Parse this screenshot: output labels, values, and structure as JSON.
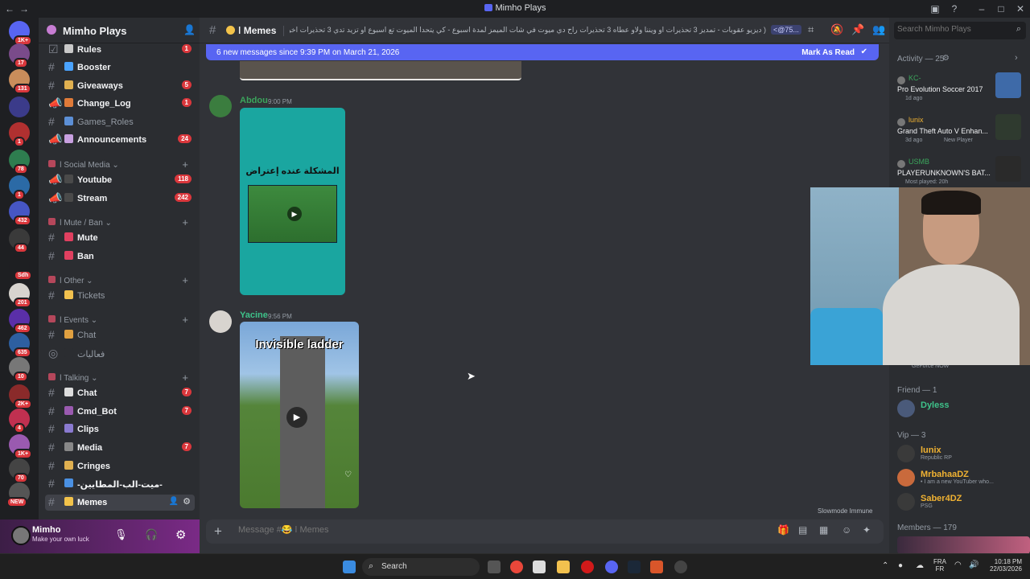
{
  "window": {
    "title": "Mimho Plays"
  },
  "rail": {
    "badges": [
      "1K+",
      "17",
      "131",
      "",
      "1",
      "78",
      "1",
      "432",
      "44",
      "Sdh",
      "201",
      "462",
      "635",
      "10",
      "2K+",
      "4",
      "1K+",
      "70",
      "NEW"
    ]
  },
  "guild": {
    "name": "Mimho Plays"
  },
  "channels": [
    {
      "label": "Rules",
      "badge": "1",
      "unread": true,
      "kind": "rules"
    },
    {
      "label": "Booster",
      "badge": "",
      "unread": true,
      "kind": "text"
    },
    {
      "label": "Giveaways",
      "badge": "5",
      "unread": true,
      "kind": "text"
    },
    {
      "label": "Change_Log",
      "badge": "1",
      "unread": true,
      "kind": "announce"
    },
    {
      "label": "Games_Roles",
      "badge": "",
      "unread": false,
      "kind": "text"
    },
    {
      "label": "Announcements",
      "badge": "24",
      "unread": true,
      "kind": "announce"
    }
  ],
  "categories": {
    "social": "Social Media",
    "mute": "Mute / Ban",
    "other": "Other",
    "events": "Events",
    "talking": "Talking"
  },
  "social_channels": [
    {
      "label": "Youtube",
      "badge": "118"
    },
    {
      "label": "Stream",
      "badge": "242"
    }
  ],
  "mute_channels": [
    {
      "label": "Mute"
    },
    {
      "label": "Ban"
    }
  ],
  "other_channels": [
    {
      "label": "Tickets"
    }
  ],
  "events_channels": [
    {
      "label": "Chat"
    },
    {
      "label": "فعاليات"
    }
  ],
  "talking_channels": [
    {
      "label": "Chat",
      "badge": "7"
    },
    {
      "label": "Cmd_Bot",
      "badge": "7"
    },
    {
      "label": "Clips",
      "badge": ""
    },
    {
      "label": "Media",
      "badge": "7"
    },
    {
      "label": "Cringes",
      "badge": ""
    },
    {
      "label": "-ميت-الب-المطايين-",
      "badge": ""
    },
    {
      "label": "Memes",
      "badge": ""
    }
  ],
  "user": {
    "name": "Mimho",
    "status": "Make your own luck"
  },
  "channel_header": {
    "name": "Memes",
    "topic": "( ديزيو عقوبات - تمديز 3 تحذيرات او ويننا ولاو عطاه 3 تحذيرات راح دي ميوت في شات الميمز لمدة اسبوع - كي يتحدا الميوت تع اسبوع او تزيد تدي 3 تحذيرات اخرى راح دي ميوت تع شهر من شات الميمز",
    "mention": "<@75..."
  },
  "new_messages": {
    "text": "6 new messages since 9:39 PM on March 21, 2026",
    "action": "Mark As Read"
  },
  "messages": [
    {
      "author": "Abdou",
      "time": "9:00 PM",
      "caption": "المشكلة عنده إعتراض"
    },
    {
      "author": "Yacine",
      "time": "9:56 PM",
      "caption": "Invisible ladder"
    }
  ],
  "composer": {
    "placeholder": "Message #😂 ǀ Memes"
  },
  "slowmode": "Slowmode Immune",
  "search": {
    "placeholder": "Search Mimho Plays"
  },
  "activity": {
    "header": "Activity — 25",
    "items": [
      {
        "user": "KC-",
        "game": "Pro Evolution Soccer 2017",
        "meta": "1d ago",
        "extra": ""
      },
      {
        "user": "lunix",
        "game": "Grand Theft Auto V Enhan...",
        "meta": "3d ago",
        "extra": "New Player"
      },
      {
        "user": "USMB",
        "game": "PLAYERUNKNOWN'S BAT...",
        "meta": "Most played: 20h",
        "extra": ""
      }
    ],
    "geforce": "GeForce NOW"
  },
  "members": {
    "friend_header": "Friend — 1",
    "friends": [
      {
        "name": "Dyless",
        "status": ""
      }
    ],
    "vip_header": "Vip — 3",
    "vips": [
      {
        "name": "lunix",
        "status": "Republic RP"
      },
      {
        "name": "MrbahaaDZ",
        "status": "• I am a new YouTuber who..."
      },
      {
        "name": "Saber4DZ",
        "status": "PSG"
      }
    ],
    "members_header": "Members — 179"
  },
  "taskbar": {
    "search": "Search",
    "lang": "FRA",
    "lang2": "FR",
    "time": "10:18 PM",
    "date": "22/03/2026"
  },
  "colors": {
    "accent": "#5865f2",
    "badge": "#da373c",
    "online": "#23a55a"
  }
}
